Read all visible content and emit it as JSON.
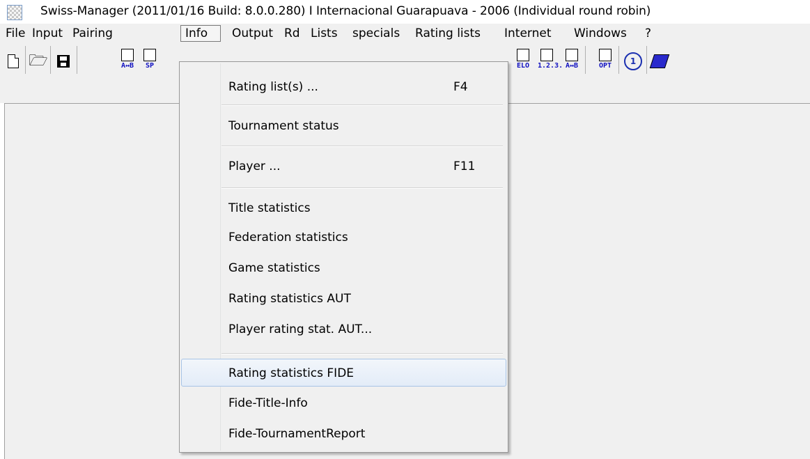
{
  "window": {
    "title": "Swiss-Manager (2011/01/16 Build: 8.0.0.280) I Internacional Guarapuava - 2006    (Individual round robin)"
  },
  "menubar": {
    "items": [
      {
        "label": "File"
      },
      {
        "label": "Input"
      },
      {
        "label": "Pairing"
      },
      {
        "label": "Info"
      },
      {
        "label": "Output"
      },
      {
        "label": "Rd"
      },
      {
        "label": "Lists"
      },
      {
        "label": "specials"
      },
      {
        "label": "Rating lists"
      },
      {
        "label": "Internet"
      },
      {
        "label": "Windows"
      },
      {
        "label": "?"
      }
    ]
  },
  "toolbar": {
    "buttons": [
      {
        "icon": "new-document-icon"
      },
      {
        "icon": "open-folder-icon"
      },
      {
        "icon": "save-icon",
        "color": "#000000"
      },
      {
        "icon": "sort-ab-icon",
        "caption": "A↔B"
      },
      {
        "icon": "sp-icon",
        "caption": "SP"
      },
      {
        "icon": "sort-elo-icon",
        "caption": "ELO"
      },
      {
        "icon": "sort-123-icon",
        "caption": "1.2.3."
      },
      {
        "icon": "list-ab-icon",
        "caption": "A↔B"
      },
      {
        "icon": "options-icon",
        "caption": "OPT"
      },
      {
        "icon": "chess-round-icon",
        "caption": "1"
      },
      {
        "icon": "help-book-icon"
      }
    ]
  },
  "info_menu": {
    "items": [
      {
        "label": "Rating list(s) ...",
        "shortcut": "F4"
      },
      {
        "label": "Tournament status",
        "shortcut": ""
      },
      {
        "label": "Player ...",
        "shortcut": "F11"
      },
      {
        "label": "Title statistics",
        "shortcut": ""
      },
      {
        "label": "Federation statistics",
        "shortcut": ""
      },
      {
        "label": "Game statistics",
        "shortcut": ""
      },
      {
        "label": "Rating statistics AUT",
        "shortcut": ""
      },
      {
        "label": "Player rating stat. AUT...",
        "shortcut": ""
      },
      {
        "label": "Rating statistics FIDE",
        "shortcut": ""
      },
      {
        "label": "Fide-Title-Info",
        "shortcut": ""
      },
      {
        "label": "Fide-TournamentReport",
        "shortcut": ""
      }
    ],
    "highlighted": "Rating statistics FIDE"
  },
  "colors": {
    "menu_background": "#f0f0f0",
    "highlight_border": "#a8c4e6",
    "icon_blue": "#1010c0"
  }
}
